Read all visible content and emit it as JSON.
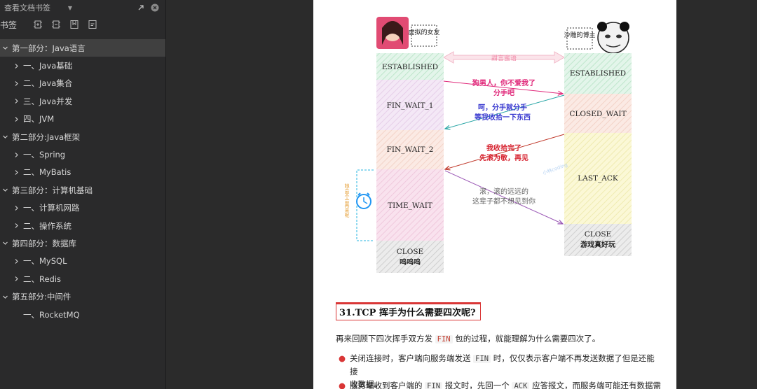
{
  "sidebar": {
    "title": "查看文档书签",
    "toolbar_label": "书签",
    "items": [
      {
        "label": "第一部分：Java语言",
        "level": 0,
        "expanded": true,
        "selected": true
      },
      {
        "label": "一、Java基础",
        "level": 1,
        "expanded": false
      },
      {
        "label": "二、Java集合",
        "level": 1,
        "expanded": false
      },
      {
        "label": "三、Java并发",
        "level": 1,
        "expanded": false
      },
      {
        "label": "四、JVM",
        "level": 1,
        "expanded": false
      },
      {
        "label": "第二部分:Java框架",
        "level": 0,
        "expanded": true
      },
      {
        "label": "一、Spring",
        "level": 1,
        "expanded": false
      },
      {
        "label": "二、MyBatis",
        "level": 1,
        "expanded": false
      },
      {
        "label": "第三部分：计算机基础",
        "level": 0,
        "expanded": true
      },
      {
        "label": "一、计算机网路",
        "level": 1,
        "expanded": false
      },
      {
        "label": "二、操作系统",
        "level": 1,
        "expanded": false
      },
      {
        "label": "第四部分：数据库",
        "level": 0,
        "expanded": true
      },
      {
        "label": "一、MySQL",
        "level": 1,
        "expanded": false
      },
      {
        "label": "二、Redis",
        "level": 1,
        "expanded": false
      },
      {
        "label": "第五部分:中间件",
        "level": 0,
        "expanded": true
      },
      {
        "label": "一、RocketMQ",
        "level": 1,
        "leaf": true
      }
    ]
  },
  "diagram": {
    "left_person_caption": "虚拟的女友",
    "right_person_caption": "沙雕的博主",
    "channel_label": "甜言蜜语",
    "left_states": [
      "ESTABLISHED",
      "FIN_WAIT_1",
      "FIN_WAIT_2",
      "TIME_WAIT",
      "CLOSE",
      "呜呜呜"
    ],
    "right_states": [
      "ESTABLISHED",
      "CLOSED_WAIT",
      "LAST_ACK",
      "CLOSE",
      "游戏真好玩"
    ],
    "messages": {
      "m1_line1": "狗男人，你不爱我了",
      "m1_line2": "分手吧",
      "m2_line1": "呵，分手就分手",
      "m2_line2": "等我收拾一下东西",
      "m3_line1": "我收拾完了",
      "m3_line2": "先滚为敬，再见",
      "m4_line1": "滚，滚的远远的",
      "m4_line2": "这辈子都不想见到你"
    },
    "wait_note": "她会不会再来呢",
    "watermark": "小林coding"
  },
  "article": {
    "heading": "31.TCP 挥手为什么需要四次呢?",
    "intro_before": "再来回顾下四次挥手双方发",
    "intro_code": "FIN",
    "intro_after": "包的过程，就能理解为什么需要四次了。",
    "bullet1_before": "关闭连接时，客户端向服务端发送",
    "bullet1_code": "FIN",
    "bullet1_after": "时，仅仅表示客户端不再发送数据了但是还能接",
    "bullet1_line2": "收数据。",
    "bullet2_before": "服务端收到客户端的",
    "bullet2_code1": "FIN",
    "bullet2_mid": "报文时，先回一个",
    "bullet2_code2": "ACK",
    "bullet2_after": "应答报文，而服务端可能还有数据需"
  },
  "colors": {
    "sidebar_bg": "#2a2a2b",
    "selected_row": "#404040",
    "heading_accent": "#d93636",
    "msg_pink": "#e0287a",
    "msg_blue": "#3a3ad0",
    "msg_red": "#d61f2c",
    "msg_purple": "#9b59b6"
  },
  "icons": {
    "header": [
      "external-window-icon",
      "close-circle-icon"
    ],
    "toolbar": [
      "expand-all-icon",
      "collapse-all-icon",
      "add-bookmark-icon",
      "edit-bookmark-icon"
    ]
  }
}
